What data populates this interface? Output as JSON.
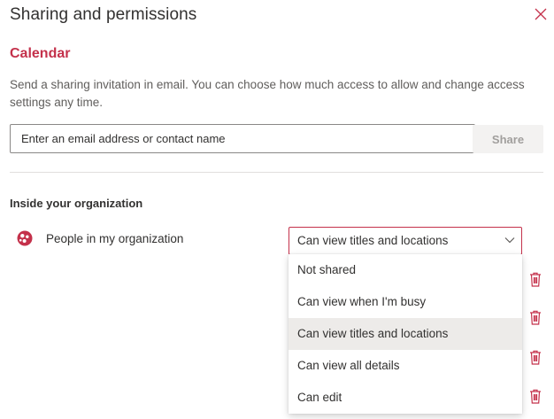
{
  "dialog": {
    "title": "Sharing and permissions",
    "close_icon": "close-icon"
  },
  "section": {
    "title": "Calendar",
    "description": "Send a sharing invitation in email. You can choose how much access to allow and change access settings any time."
  },
  "invite": {
    "placeholder": "Enter an email address or contact name",
    "value": "",
    "share_label": "Share"
  },
  "organization": {
    "heading": "Inside your organization",
    "entry_label": "People in my organization",
    "entry_icon": "people-group-icon",
    "permission_selected": "Can view titles and locations"
  },
  "permission_options": [
    {
      "label": "Not shared",
      "selected": false
    },
    {
      "label": "Can view when I'm busy",
      "selected": false
    },
    {
      "label": "Can view titles and locations",
      "selected": true
    },
    {
      "label": "Can view all details",
      "selected": false
    },
    {
      "label": "Can edit",
      "selected": false
    }
  ],
  "trash_icons": [
    "trash-icon",
    "trash-icon",
    "trash-icon",
    "trash-icon"
  ],
  "colors": {
    "accent": "#c4314b",
    "text": "#323130",
    "secondary_text": "#605e5c",
    "disabled_button_bg": "#f3f2f1",
    "disabled_button_text": "#a19f9d",
    "selected_option_bg": "#edebe9",
    "divider": "#e1dfdd"
  }
}
